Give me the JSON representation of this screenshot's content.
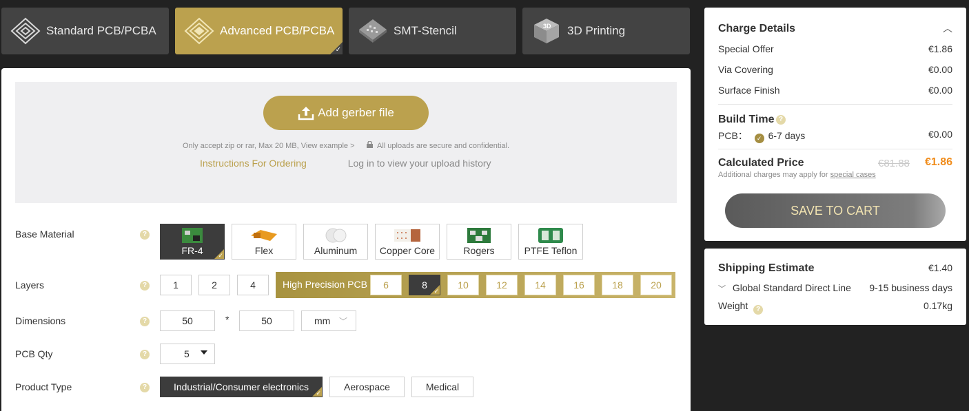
{
  "tabs": [
    {
      "label": "Standard PCB/PCBA",
      "icon": "pcb-chip-icon"
    },
    {
      "label": "Advanced PCB/PCBA",
      "icon": "pcb-chip-icon",
      "active": true
    },
    {
      "label": "SMT-Stencil",
      "icon": "stencil-icon"
    },
    {
      "label": "3D Printing",
      "icon": "cube-3d-icon"
    }
  ],
  "upload": {
    "button_label": "Add gerber file",
    "note": "Only accept zip or rar, Max 20 MB, View example >",
    "secure_note": "All uploads are secure and confidential.",
    "instructions_link": "Instructions For Ordering",
    "history_link": "Log in to view your upload history"
  },
  "form": {
    "base_material": {
      "label": "Base Material",
      "options": [
        "FR-4",
        "Flex",
        "Aluminum",
        "Copper Core",
        "Rogers",
        "PTFE Teflon"
      ],
      "selected": "FR-4"
    },
    "layers": {
      "label": "Layers",
      "options": [
        "1",
        "2",
        "4"
      ],
      "high_precision_label": "High Precision PCB",
      "high_precision_options": [
        "6",
        "8",
        "10",
        "12",
        "14",
        "16",
        "18",
        "20"
      ],
      "selected": "8"
    },
    "dimensions": {
      "label": "Dimensions",
      "width": "50",
      "separator": "*",
      "height": "50",
      "unit": "mm"
    },
    "pcb_qty": {
      "label": "PCB Qty",
      "value": "5"
    },
    "product_type": {
      "label": "Product Type",
      "options": [
        "Industrial/Consumer electronics",
        "Aerospace",
        "Medical"
      ],
      "selected": "Industrial/Consumer electronics"
    }
  },
  "charge_details": {
    "title": "Charge Details",
    "rows": [
      {
        "label": "Special Offer",
        "value": "€1.86"
      },
      {
        "label": "Via Covering",
        "value": "€0.00"
      },
      {
        "label": "Surface Finish",
        "value": "€0.00"
      }
    ],
    "build_time": {
      "title": "Build Time",
      "pcb_label": "PCB：",
      "option": "6-7 days",
      "value": "€0.00"
    },
    "calculated": {
      "title": "Calculated Price",
      "old_price": "€81.88",
      "price": "€1.86",
      "note": "Additional charges may apply for",
      "note_link": "special cases"
    },
    "save_button": "SAVE TO CART"
  },
  "shipping": {
    "title": "Shipping Estimate",
    "price": "€1.40",
    "method": "Global Standard Direct Line",
    "duration": "9-15 business days",
    "weight_label": "Weight",
    "weight": "0.17kg"
  },
  "colors": {
    "accent": "#bba14e",
    "price_orange": "#f08c1b",
    "dark": "#222222"
  }
}
